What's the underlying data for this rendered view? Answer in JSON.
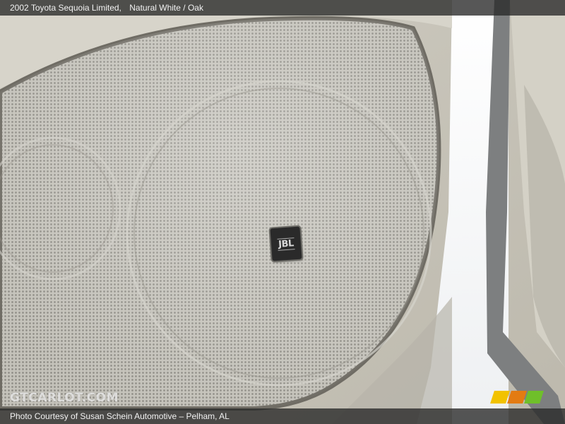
{
  "caption": {
    "vehicle": "2002 Toyota Sequoia Limited,",
    "colors": "Natural White / Oak"
  },
  "credit": "Photo Courtesy of Susan Schein Automotive  – Pelham, AL",
  "watermark": "GTCARLOT.COM",
  "badge": "JBL",
  "brand_logo_colors": [
    "#f2c200",
    "#e37b12",
    "#6fbf2a"
  ]
}
